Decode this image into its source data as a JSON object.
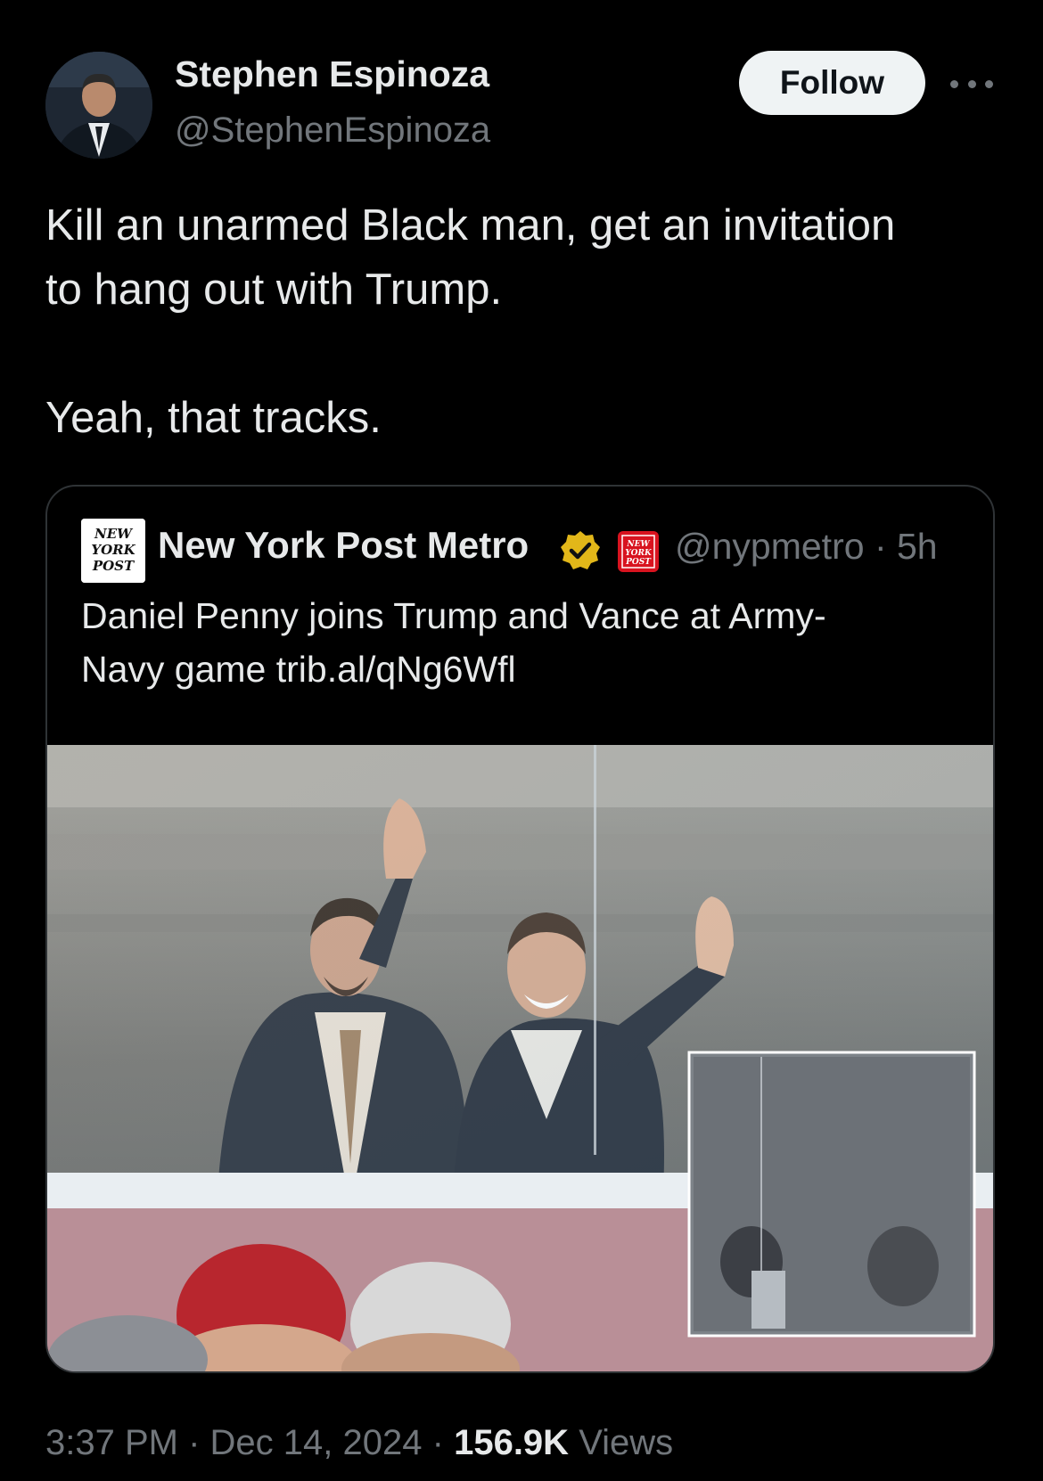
{
  "author": {
    "name": "Stephen Espinoza",
    "handle": "@StephenEspinoza",
    "avatar": "person-in-suit-avatar"
  },
  "actions": {
    "follow_label": "Follow",
    "more_icon": "more-horizontal-icon"
  },
  "tweet": {
    "lines": [
      "Kill an unarmed Black man, get an invitation",
      "to hang out with Trump.",
      "Yeah, that tracks."
    ]
  },
  "quoted_tweet": {
    "logo_text": [
      "NEW",
      "YORK",
      "POST"
    ],
    "name": "New York Post Metro",
    "verified_icon": "gold-verified-badge-icon",
    "affiliate_icon": "new-york-post-affiliate-icon",
    "handle": "@nypmetro",
    "separator": "·",
    "time": "5h",
    "text_lines": [
      "Daniel Penny joins Trump and Vance at Army-",
      "Navy game trib.al/qNg6Wfl"
    ],
    "image": "photo-men-waving-from-stadium-box-with-inset"
  },
  "meta": {
    "time": "3:37 PM",
    "separator": "·",
    "date": "Dec 14, 2024",
    "views_count": "156.9K",
    "views_label": "Views"
  },
  "colors": {
    "background": "#000000",
    "text_primary": "#e7e9ea",
    "text_secondary": "#71767b",
    "border": "#2f3336",
    "follow_bg": "#eff3f4",
    "verified_gold": "#e2b719",
    "affiliate_red": "#d8131f"
  }
}
